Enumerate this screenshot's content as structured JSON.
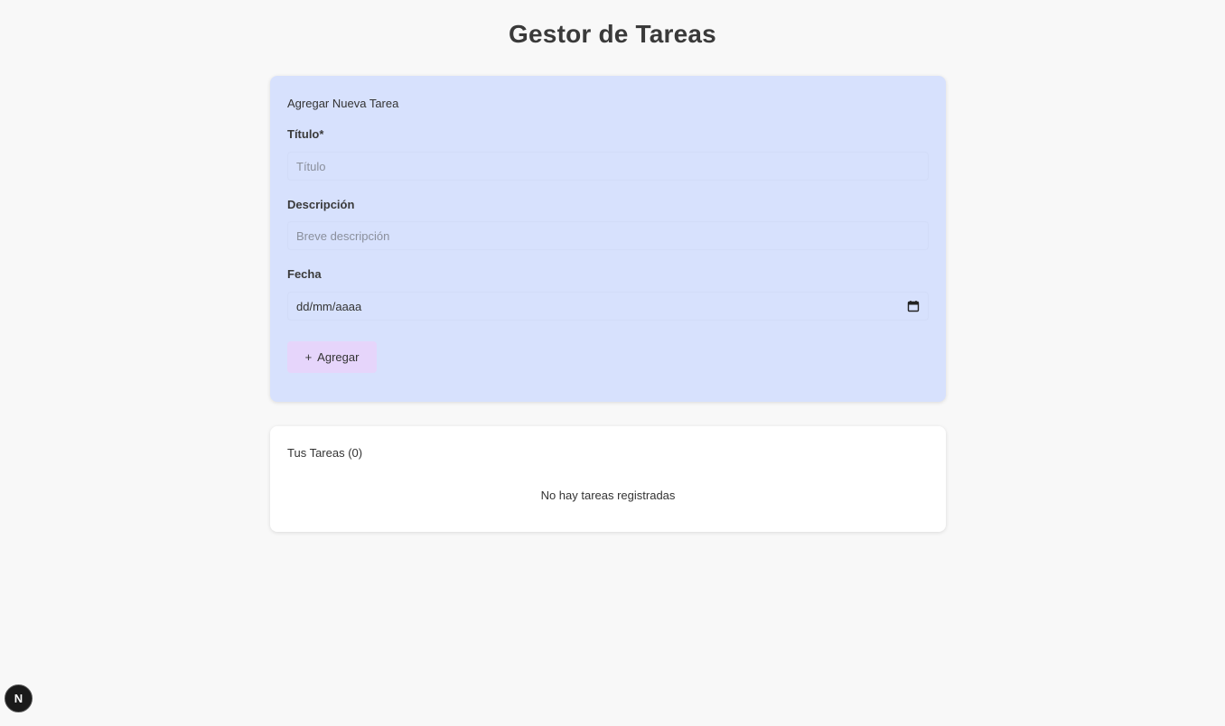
{
  "app": {
    "title": "Gestor de Tareas"
  },
  "form": {
    "heading": "Agregar Nueva Tarea",
    "title_label": "Título*",
    "title_value": "",
    "title_placeholder": "Título",
    "description_label": "Descripción",
    "description_value": "",
    "description_placeholder": "Breve descripción",
    "date_label": "Fecha",
    "date_placeholder": "dd/mm/aaaa",
    "date_icon": "calendar-icon",
    "add_button_icon": "+",
    "add_button_label": "Agregar"
  },
  "task_list": {
    "heading": "Tus Tareas (0)",
    "empty_message": "No hay tareas registradas"
  },
  "dev_badge": {
    "letter": "N"
  },
  "colors": {
    "page_background": "#f8f8f8",
    "form_card_background": "#d7e1fd",
    "list_card_background": "#ffffff",
    "add_button_background": "#e6d5fb",
    "dev_badge_background": "#1a1a1a"
  }
}
